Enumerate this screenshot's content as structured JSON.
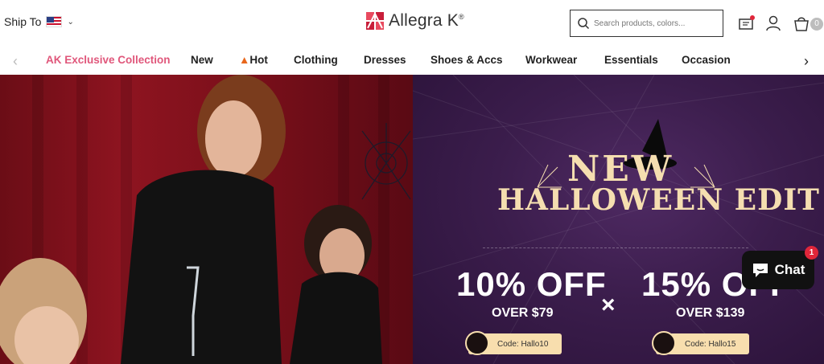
{
  "header": {
    "ship_to_label": "Ship To",
    "ship_to_country": "us-flag",
    "logo_text": "Allegra K",
    "logo_mark": "®",
    "search_placeholder": "Search products, colors...",
    "cart_count": "0",
    "icons": [
      "coupon-icon",
      "user-icon",
      "cart-icon",
      "search-icon"
    ]
  },
  "nav": {
    "items": [
      {
        "label": "AK Exclusive Collection"
      },
      {
        "label": "New"
      },
      {
        "label": "Hot",
        "icon": "fire-icon"
      },
      {
        "label": "Clothing"
      },
      {
        "label": "Dresses"
      },
      {
        "label": "Shoes & Accs"
      },
      {
        "label": "Workwear"
      },
      {
        "label": "Essentials"
      },
      {
        "label": "Occasion"
      }
    ],
    "accent_color": "#e0577b"
  },
  "banner": {
    "headline_line1": "NEW",
    "headline_line2": "HALLOWEEN EDIT",
    "offers": [
      {
        "discount": "10% OFF",
        "condition": "OVER $79",
        "code": "Code: Hallo10"
      },
      {
        "discount": "15% OFF",
        "condition": "OVER $139",
        "code": "Code: Hallo15"
      }
    ],
    "separator": "×",
    "headline_color": "#f5deb0",
    "background_color": "#3b1d4c"
  },
  "chat": {
    "label": "Chat",
    "badge": "1",
    "badge_color": "#e0263a"
  }
}
